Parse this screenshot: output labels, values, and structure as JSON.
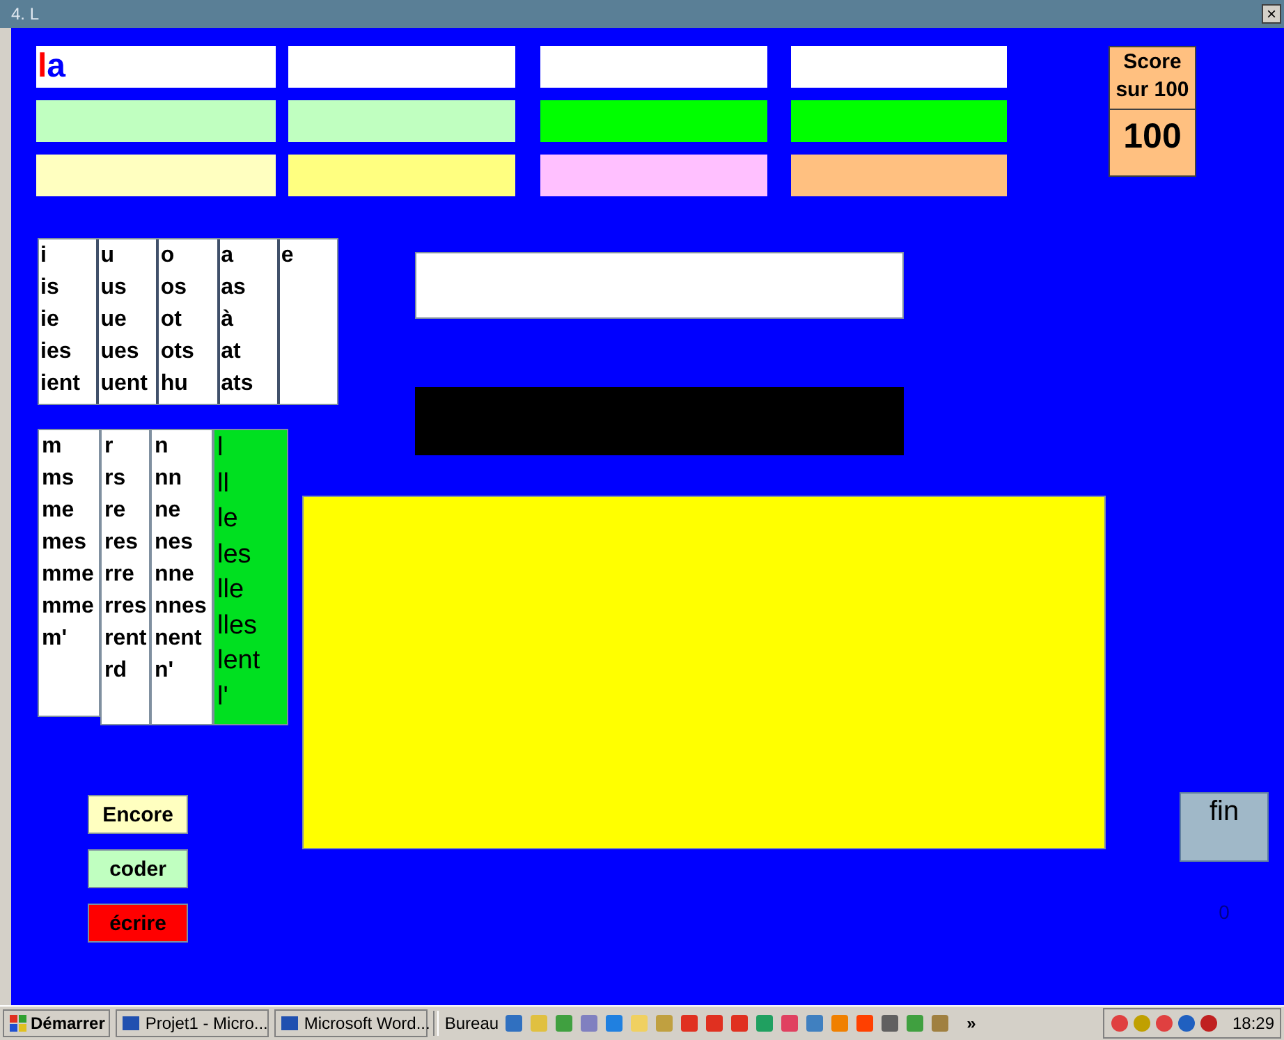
{
  "window": {
    "title": "4. L",
    "close": "×"
  },
  "tiles": [
    {
      "segments": [
        {
          "text": "l",
          "color": "#ff0000"
        },
        {
          "text": "a",
          "color": "#0000ff"
        }
      ],
      "color": "#ffffff"
    },
    {
      "color": "#ffffff"
    },
    {
      "color": "#ffffff"
    },
    {
      "color": "#ffffff"
    },
    {
      "color": "#c0ffc0"
    },
    {
      "color": "#c0ffc0"
    },
    {
      "color": "#00ff00"
    },
    {
      "color": "#00ff00"
    },
    {
      "color": "#ffffc0"
    },
    {
      "color": "#ffff80"
    },
    {
      "color": "#ffc0ff"
    },
    {
      "color": "#ffc080"
    }
  ],
  "score": {
    "label": "Score sur 100",
    "value": "100"
  },
  "vowels": [
    {
      "items": [
        "i",
        "is",
        "ie",
        "ies",
        "ient"
      ]
    },
    {
      "items": [
        "u",
        "us",
        "ue",
        "ues",
        "uent"
      ]
    },
    {
      "items": [
        "o",
        "os",
        "ot",
        "ots",
        "hu"
      ]
    },
    {
      "items": [
        "a",
        "as",
        "à",
        "at",
        "ats"
      ]
    },
    {
      "items": [
        "e"
      ]
    }
  ],
  "consonants": [
    {
      "items": [
        "m",
        "ms",
        "me",
        "mes",
        "mme",
        "mme",
        "m'"
      ],
      "selected": false
    },
    {
      "items": [
        "r",
        "rs",
        "re",
        "res",
        "rre",
        "rres",
        "rent",
        "rd"
      ],
      "selected": false
    },
    {
      "items": [
        "n",
        "nn",
        "ne",
        "nes",
        "nne",
        "nnes",
        "nent",
        "n'"
      ],
      "selected": false
    },
    {
      "items": [
        "l",
        "ll",
        "le",
        "les",
        "lle",
        "lles",
        "lent",
        "l'"
      ],
      "selected": true
    }
  ],
  "buttons": [
    {
      "label": "Encore",
      "color": "#ffffc0"
    },
    {
      "label": "coder",
      "color": "#c0ffc0"
    },
    {
      "label": "écrire",
      "color": "#ff0000"
    }
  ],
  "fin": "fin",
  "counter": "0",
  "taskbar": {
    "start": "Démarrer",
    "tasks": [
      "Projet1 - Micro...",
      "Microsoft Word..."
    ],
    "toolbar": "Bureau",
    "more": "»",
    "clock": "18:29"
  }
}
